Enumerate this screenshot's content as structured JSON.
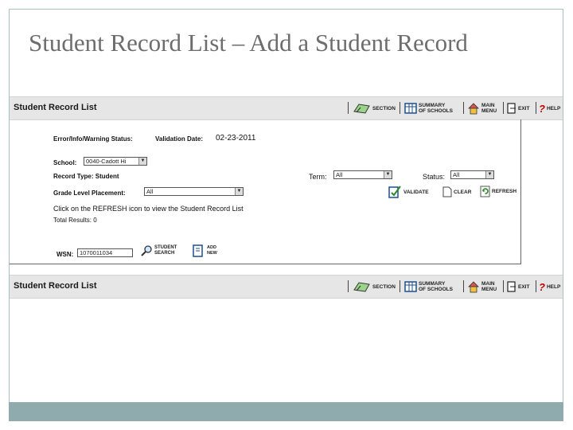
{
  "slide": {
    "title": "Student Record List – Add a Student Record"
  },
  "toolbar": {
    "title": "Student Record List",
    "section_label": "SECTION",
    "summary_line1": "SUMMARY",
    "summary_line2": "OF SCHOOLS",
    "main_line1": "MAIN",
    "main_line2": "MENU",
    "exit_label": "EXIT",
    "help_label": "HELP"
  },
  "form": {
    "status_label": "Error/Info/Warning Status:",
    "validation_label": "Validation Date:",
    "validation_date": "02-23-2011",
    "school_label": "School:",
    "school_value": "0040-Cadott Hi",
    "record_type_label": "Record Type: Student",
    "term_label": "Term:",
    "term_value": "All",
    "status_field_label": "Status:",
    "status_value": "All",
    "grade_label": "Grade Level Placement:",
    "grade_value": "All",
    "validate_label": "VALIDATE",
    "clear_label": "CLEAR",
    "refresh_label": "REFRESH",
    "refresh_hint": "Click on the REFRESH icon to view the Student Record List",
    "total_results": "Total Results: 0",
    "wsn_label": "WSN:",
    "wsn_value": "1070011034",
    "student_search_line1": "STUDENT",
    "student_search_line2": "SEARCH",
    "add_new_line1": "ADD",
    "add_new_line2": "NEW"
  },
  "colors": {
    "toolbar_bg": "#e6e6e6",
    "frame_border": "#a9bfc1",
    "bottom_band": "#8fabad"
  }
}
